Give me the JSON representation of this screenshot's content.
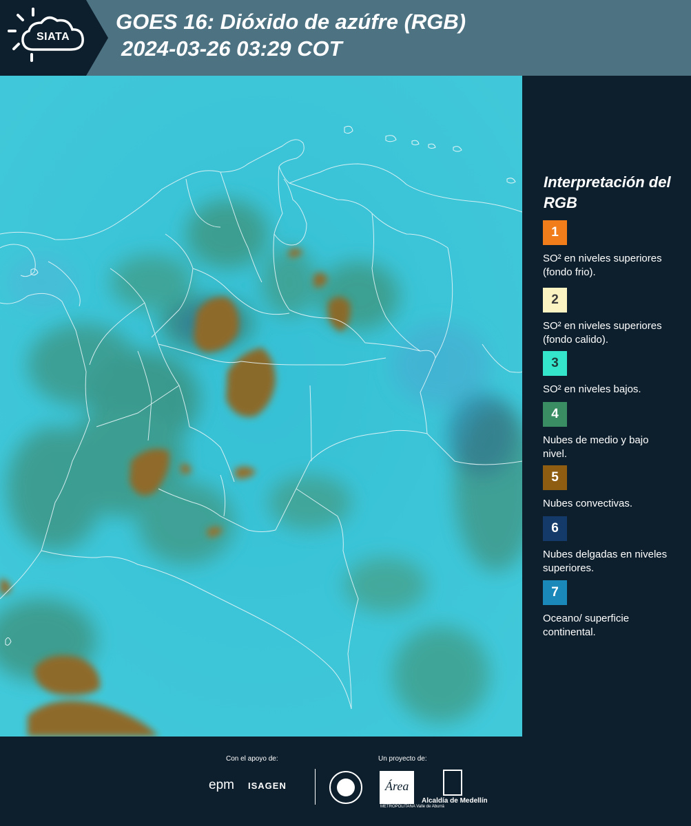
{
  "header": {
    "logo_text": "SIATA",
    "title_line1": "GOES 16: Dióxido de azúfre (RGB)",
    "title_line2": "2024-03-26 03:29 COT"
  },
  "legend": {
    "title": "Interpretación del RGB",
    "items": [
      {
        "number": "1",
        "color": "#f07c1a",
        "text_color": "#ffffff",
        "label": "SO² en niveles superiores (fondo frio)."
      },
      {
        "number": "2",
        "color": "#fbf3c2",
        "text_color": "#3a3a3a",
        "label": "SO² en niveles superiores (fondo calido)."
      },
      {
        "number": "3",
        "color": "#34e5cc",
        "text_color": "#1d3b3a",
        "label": "SO² en niveles bajos."
      },
      {
        "number": "4",
        "color": "#3a8d63",
        "text_color": "#ffffff",
        "label": "Nubes de medio y bajo nivel."
      },
      {
        "number": "5",
        "color": "#8f5d12",
        "text_color": "#ffffff",
        "label": "Nubes convectivas."
      },
      {
        "number": "6",
        "color": "#133a68",
        "text_color": "#ffffff",
        "label": "Nubes delgadas en niveles superiores."
      },
      {
        "number": "7",
        "color": "#1a88b9",
        "text_color": "#ffffff",
        "label": "Oceano/ superficie continental."
      }
    ]
  },
  "footer": {
    "support_label": "Con el apoyo de:",
    "project_label": "Un proyecto de:",
    "sponsor1": "epm",
    "sponsor2": "ISAGEN",
    "partner_area": "Área",
    "partner_area_sub": "METROPOLITANA Valle de Aburrá",
    "partner_alcaldia": "Alcaldía de Medellín"
  },
  "colors": {
    "header_bg": "#4d7383",
    "panel_bg": "#0d1f2d",
    "map_base": "#3cc6d8",
    "convective": "#8f6a2a",
    "mid_cloud": "#3e9a85"
  }
}
